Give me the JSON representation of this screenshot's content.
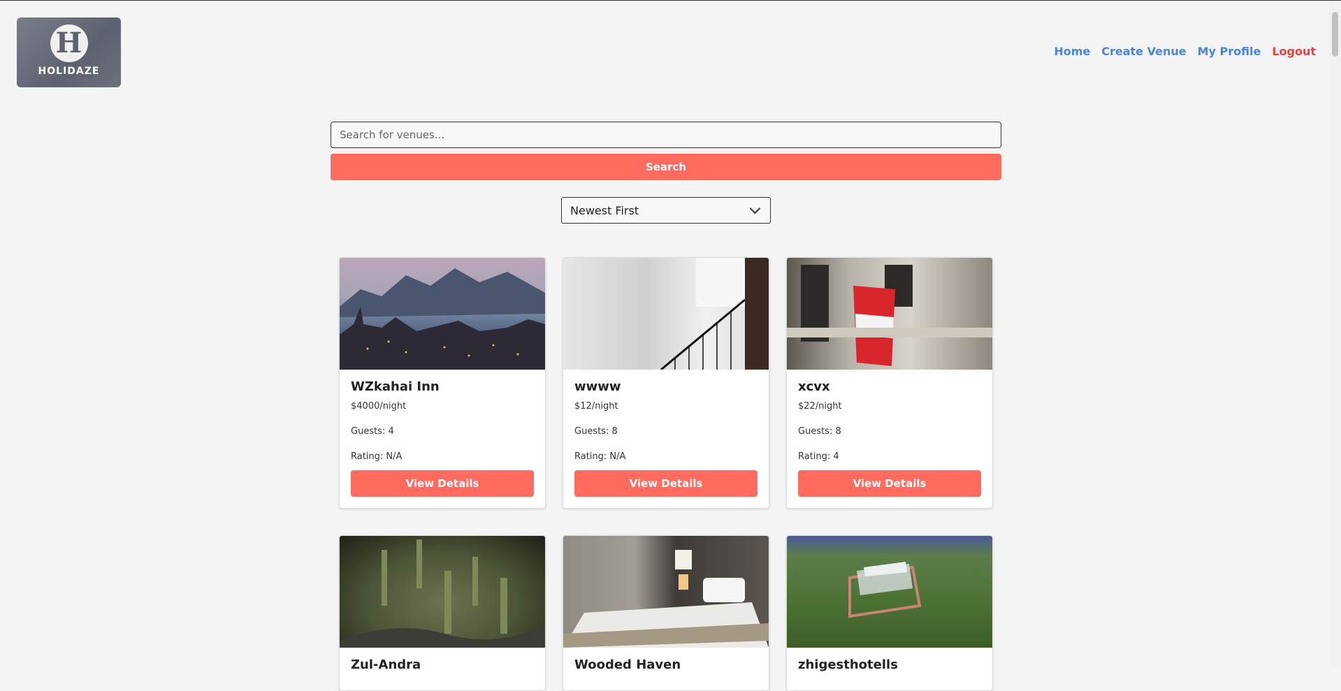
{
  "brand": {
    "logo_letter": "H",
    "logo_text": "HOLIDAZE"
  },
  "nav": {
    "home": "Home",
    "create_venue": "Create Venue",
    "my_profile": "My Profile",
    "logout": "Logout"
  },
  "search": {
    "placeholder": "Search for venues...",
    "button_label": "Search"
  },
  "sort": {
    "selected": "Newest First"
  },
  "venues": [
    {
      "name": "WZkahai Inn",
      "price": "$4000/night",
      "guests": "Guests: 4",
      "rating": "Rating: N/A",
      "button": "View Details"
    },
    {
      "name": "wwww",
      "price": "$12/night",
      "guests": "Guests: 8",
      "rating": "Rating: N/A",
      "button": "View Details"
    },
    {
      "name": "xcvx",
      "price": "$22/night",
      "guests": "Guests: 8",
      "rating": "Rating: 4",
      "button": "View Details"
    },
    {
      "name": "Zul-Andra",
      "price": "",
      "guests": "",
      "rating": "",
      "button": ""
    },
    {
      "name": "Wooded Haven",
      "price": "",
      "guests": "",
      "rating": "",
      "button": ""
    },
    {
      "name": "zhigesthotells",
      "price": "",
      "guests": "",
      "rating": "",
      "button": ""
    }
  ],
  "colors": {
    "accent": "#ff6b5e",
    "nav_link": "#4a86d8",
    "logout": "#ec3e3e",
    "background": "#f4f4f4"
  }
}
